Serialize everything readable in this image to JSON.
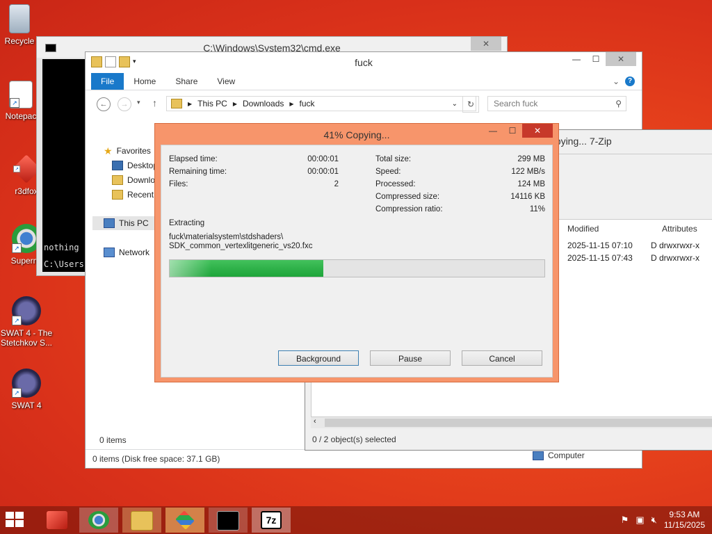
{
  "desktop": {
    "icons": [
      {
        "label": "Recycle",
        "name": "recycle-bin-icon"
      },
      {
        "label": "Notepac",
        "name": "notepad-icon"
      },
      {
        "label": "r3dfox",
        "name": "r3dfox-icon"
      },
      {
        "label": "Supermi",
        "name": "supermium-icon"
      },
      {
        "label": "SWAT 4 - The Stetchkov S...",
        "name": "swat4-stetchkov-icon"
      },
      {
        "label": "SWAT 4",
        "name": "swat4-icon"
      }
    ]
  },
  "cmd": {
    "title": "C:\\Windows\\System32\\cmd.exe",
    "line1": "nothing",
    "line2": "C:\\Users"
  },
  "explorer": {
    "title": "fuck",
    "tabs": {
      "file": "File",
      "home": "Home",
      "share": "Share",
      "view": "View"
    },
    "breadcrumb": [
      "This PC",
      "Downloads",
      "fuck"
    ],
    "search_placeholder": "Search fuck",
    "nav": {
      "favorites": "Favorites",
      "desktop": "Desktop",
      "downloads": "Downlo",
      "recent": "Recent",
      "this_pc": "This PC",
      "network": "Network"
    },
    "items_count": "0 items",
    "statusbar": "0 items (Disk free space: 37.1 GB)",
    "computer": "Computer"
  },
  "zip": {
    "title": "opying... 7-Zip",
    "columns": {
      "modified": "Modified",
      "attributes": "Attributes"
    },
    "rows": [
      {
        "modified": "2025-11-15 07:10",
        "attributes": "D drwxrwxr-x"
      },
      {
        "modified": "2025-11-15 07:43",
        "attributes": "D drwxrwxr-x"
      }
    ],
    "status": "0 / 2 object(s) selected"
  },
  "dialog": {
    "title": "41% Copying...",
    "elapsed_label": "Elapsed time:",
    "elapsed_value": "00:00:01",
    "remaining_label": "Remaining time:",
    "remaining_value": "00:00:01",
    "files_label": "Files:",
    "files_value": "2",
    "total_label": "Total size:",
    "total_value": "299 MB",
    "speed_label": "Speed:",
    "speed_value": "122 MB/s",
    "processed_label": "Processed:",
    "processed_value": "124 MB",
    "compressed_label": "Compressed size:",
    "compressed_value": "14116 KB",
    "ratio_label": "Compression ratio:",
    "ratio_value": "11%",
    "action": "Extracting",
    "path1": "fuck\\materialsystem\\stdshaders\\",
    "path2": "SDK_common_vertexlitgeneric_vs20.fxc",
    "progress_percent": 41,
    "buttons": {
      "background": "Background",
      "pause": "Pause",
      "cancel": "Cancel"
    }
  },
  "taskbar": {
    "time": "9:53 AM",
    "date": "11/15/2025"
  }
}
